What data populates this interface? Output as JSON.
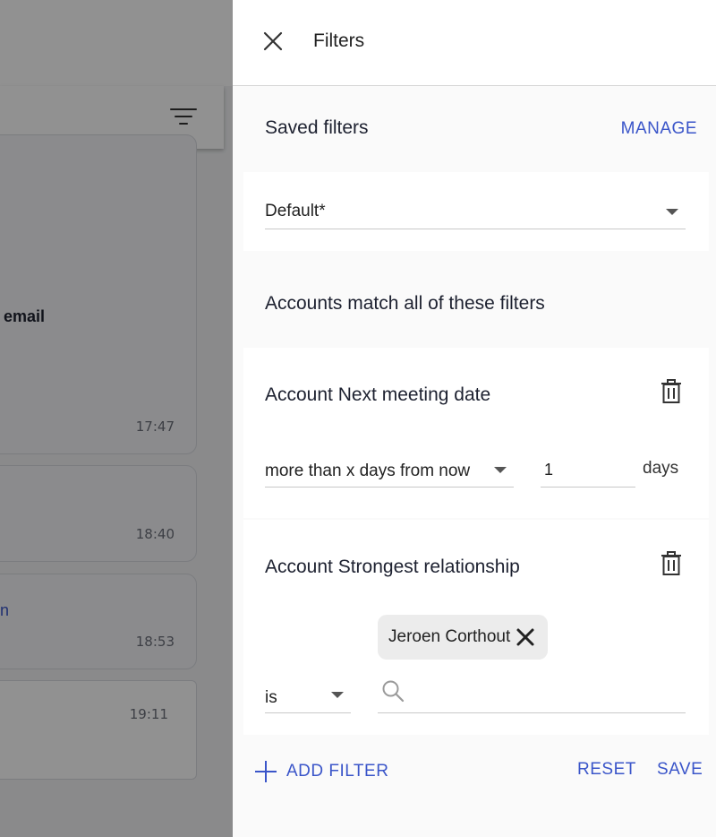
{
  "background": {
    "card_bold_text": "ur email",
    "card_link_text": "tion",
    "times": [
      "17:47",
      "18:40",
      "18:53",
      "19:11"
    ]
  },
  "drawer": {
    "title": "Filters",
    "saved_filters": {
      "heading": "Saved filters",
      "manage_label": "MANAGE",
      "selected": "Default*"
    },
    "match_heading": "Accounts match all of these filters",
    "filters": [
      {
        "title": "Account Next meeting date",
        "operator": "more than x days from now",
        "value": "1",
        "unit": "days"
      },
      {
        "title": "Account Strongest relationship",
        "operator": "is",
        "chip": "Jeroen Corthout",
        "search_placeholder": ""
      }
    ],
    "footer": {
      "add_filter": "ADD FILTER",
      "reset": "RESET",
      "save": "SAVE"
    }
  },
  "colors": {
    "accent": "#3a55c9",
    "scrim": "#000000"
  }
}
